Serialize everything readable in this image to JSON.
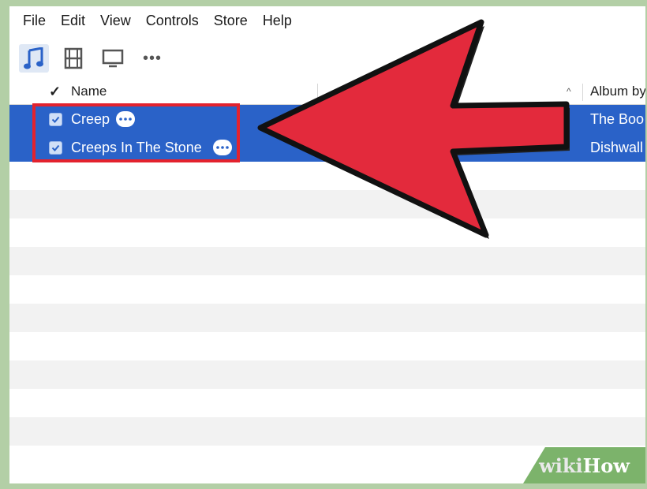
{
  "menu": [
    "File",
    "Edit",
    "View",
    "Controls",
    "Store",
    "Help"
  ],
  "toolbar": {
    "icons": [
      "music-note-icon",
      "movie-film-icon",
      "tv-icon",
      "more-dots-icon"
    ],
    "more_label": "•••"
  },
  "table": {
    "check_header": "✓",
    "name_header": "Name",
    "sort_indicator": "^",
    "album_header": "Album by",
    "rows": [
      {
        "name": "Creep",
        "album": "The Boo",
        "checked": true,
        "selected": true
      },
      {
        "name": "Creeps In The Stone",
        "album": "Dishwall",
        "checked": true,
        "selected": true
      }
    ]
  },
  "colors": {
    "selection": "#2a62c8",
    "annotation_red": "#e3222e",
    "page_border": "#b3cfa6",
    "watermark_bg": "#7cb36b"
  },
  "watermark": {
    "wiki": "wiki",
    "how": "How"
  }
}
